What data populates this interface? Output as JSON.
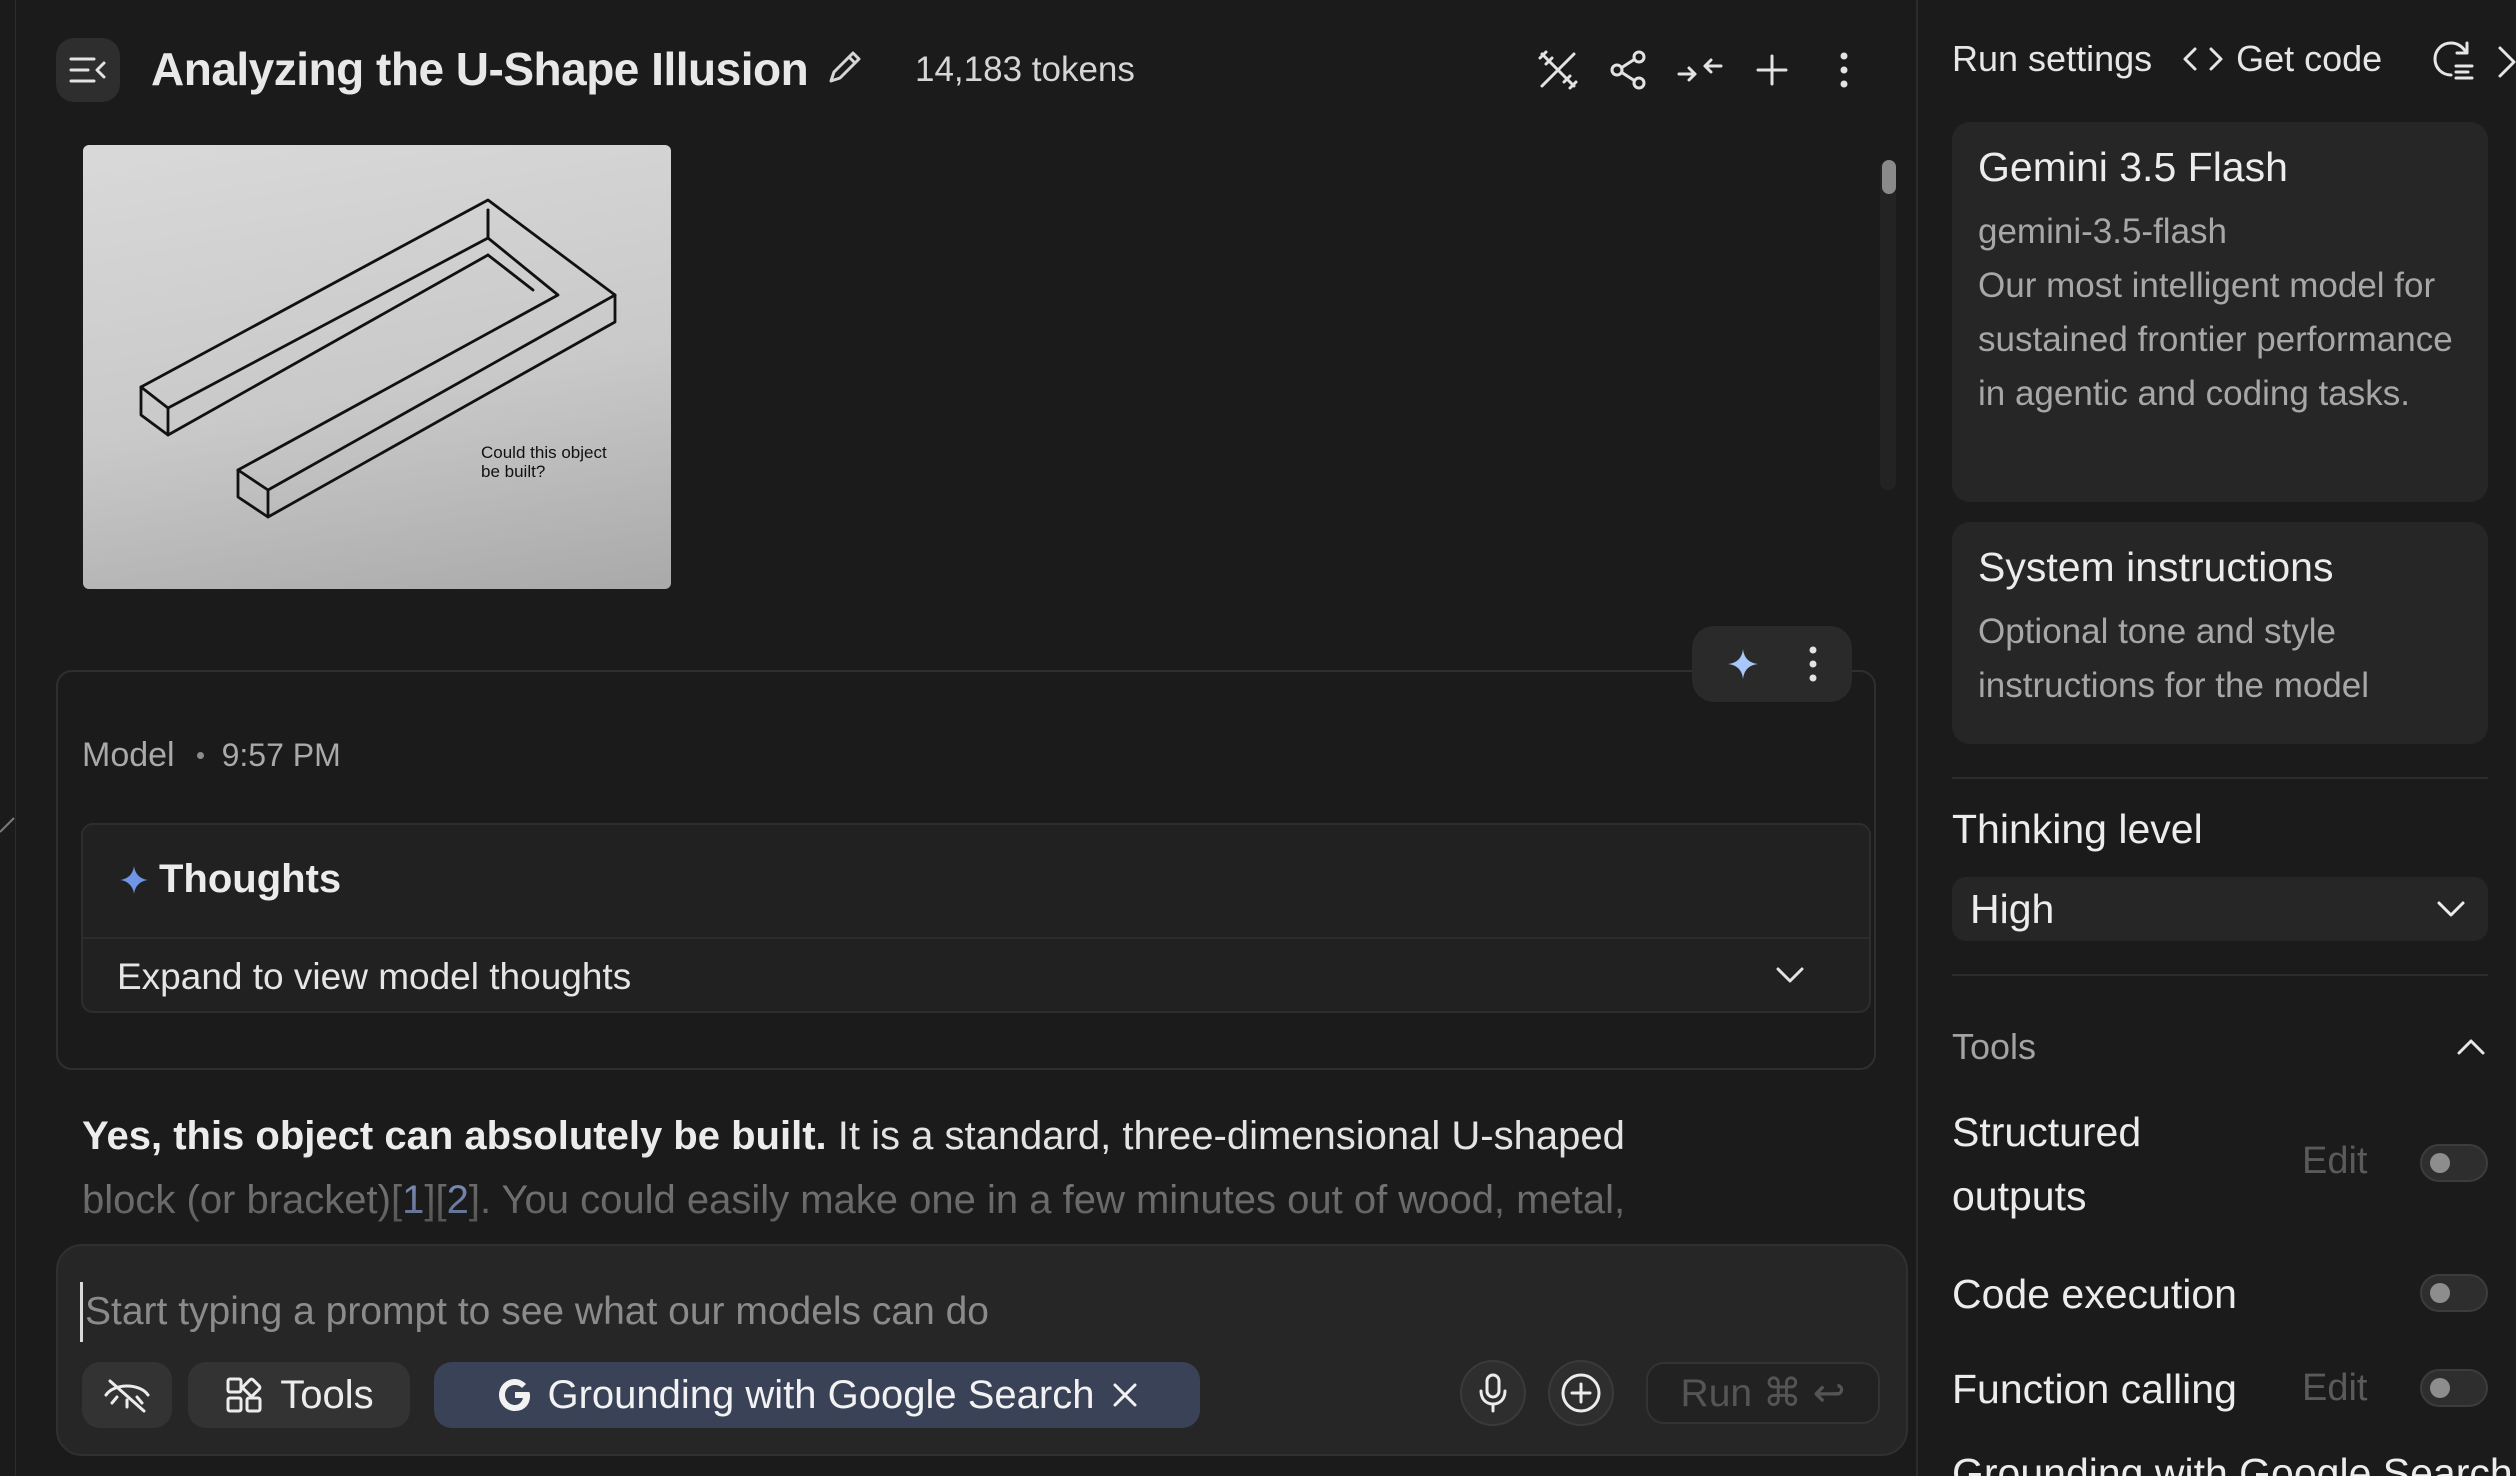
{
  "header": {
    "title": "Analyzing the U-Shape Illusion",
    "tokens": "14,183 tokens"
  },
  "icons": {
    "menu": "collapse-menu-icon",
    "edit": "pencil-icon",
    "compare": "compare-icon",
    "share": "share-icon",
    "compress": "compress-icon",
    "new": "plus-icon",
    "more": "more-vertical-icon"
  },
  "attachment": {
    "caption": "Could this object\nbe built?"
  },
  "message": {
    "role": "Model",
    "time": "9:57 PM",
    "thoughts_title": "Thoughts",
    "thoughts_expand": "Expand to view model thoughts",
    "answer_bold": "Yes, this object can absolutely be built.",
    "answer_rest1": " It is a standard, three-dimensional U-shaped",
    "answer_line2_a": "block (or bracket)",
    "cite1": "1",
    "cite2": "2",
    "answer_line2_b": ". You could easily make one in a few minutes out of wood, metal,"
  },
  "composer": {
    "placeholder": "Start typing a prompt to see what our models can do",
    "tools_label": "Tools",
    "grounding_label": "Grounding with Google Search",
    "run_label": "Run ⌘ ↩"
  },
  "right_panel": {
    "run_settings": "Run settings",
    "get_code": "Get code",
    "model_name": "Gemini 3.5 Flash",
    "model_id": "gemini-3.5-flash",
    "model_desc": "Our most intelligent model for sustained frontier performance in agentic and coding tasks.",
    "sys_title": "System instructions",
    "sys_desc": "Optional tone and style instructions for the model",
    "thinking_label": "Thinking level",
    "thinking_value": "High",
    "tools_section": "Tools",
    "tools": [
      {
        "label": "Structured\noutputs",
        "edit": "Edit",
        "enabled": false
      },
      {
        "label": "Code execution",
        "edit": "",
        "enabled": false
      },
      {
        "label": "Function calling",
        "edit": "Edit",
        "enabled": false
      }
    ],
    "partial_next": "Grounding with Google Search"
  },
  "colors": {
    "background": "#1b1b1b",
    "panel": "#262626",
    "accent_blue": "#8ab4f8",
    "chip_blue": "#3a4257"
  }
}
